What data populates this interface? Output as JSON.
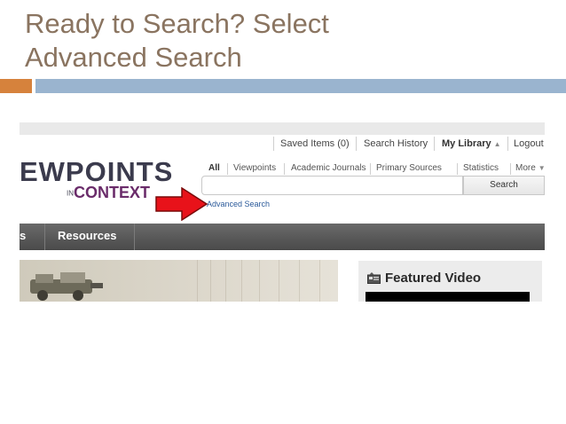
{
  "slide": {
    "title_line1": "Ready to Search? Select",
    "title_line2": "Advanced Search",
    "colors": {
      "title": "#8a7460",
      "accent_orange": "#d6823c",
      "accent_blue": "#9ab4cf"
    }
  },
  "site": {
    "util_nav": {
      "saved_items": "Saved Items (0)",
      "search_history": "Search History",
      "my_library": "My Library",
      "logout": "Logout"
    },
    "logo": {
      "main": "EWPOINTS",
      "sub_in": "IN",
      "sub_context": "CONTEXT"
    },
    "filters": [
      "All",
      "Viewpoints",
      "Academic Journals",
      "Primary Sources",
      "Statistics",
      "More"
    ],
    "search": {
      "placeholder": "",
      "button_label": "Search"
    },
    "advanced_search_link": "Advanced Search",
    "main_nav": {
      "left_fragment": "s",
      "resources": "Resources"
    },
    "featured": {
      "title": "Featured Video"
    },
    "icons": [
      "triangle-up-icon",
      "triangle-down-icon",
      "red-arrow-icon",
      "video-icon"
    ]
  }
}
